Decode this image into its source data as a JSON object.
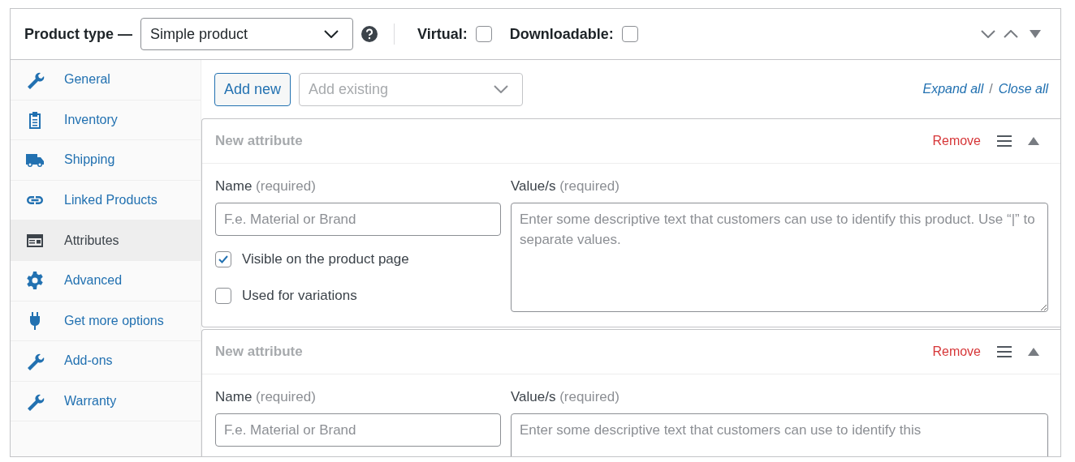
{
  "header": {
    "label": "Product type —",
    "product_type": "Simple product",
    "options": [
      {
        "label": "Virtual:",
        "checked": false
      },
      {
        "label": "Downloadable:",
        "checked": false
      }
    ]
  },
  "sidebar": {
    "items": [
      {
        "label": "General",
        "selected": false
      },
      {
        "label": "Inventory",
        "selected": false
      },
      {
        "label": "Shipping",
        "selected": false
      },
      {
        "label": "Linked Products",
        "selected": false
      },
      {
        "label": "Attributes",
        "selected": true
      },
      {
        "label": "Advanced",
        "selected": false
      },
      {
        "label": "Get more options",
        "selected": false
      },
      {
        "label": "Add-ons",
        "selected": false
      },
      {
        "label": "Warranty",
        "selected": false
      }
    ]
  },
  "toolbar": {
    "add_new": "Add new",
    "add_existing": {
      "placeholder": "Add existing"
    },
    "expand_all": "Expand all",
    "separator": "/",
    "close_all": "Close all"
  },
  "attributes": [
    {
      "title": "New attribute",
      "remove": "Remove",
      "name_label": "Name",
      "name_hint": "(required)",
      "name_placeholder": "F.e. Material or Brand",
      "values_label": "Value/s",
      "values_hint": "(required)",
      "values_placeholder": "Enter some descriptive text that customers can use to identify this product. Use “|” to separate values.",
      "options": [
        {
          "label": "Visible on the product page",
          "checked": true
        },
        {
          "label": "Used for variations",
          "checked": false
        }
      ]
    },
    {
      "title": "New attribute",
      "remove": "Remove",
      "name_label": "Name",
      "name_hint": "(required)",
      "name_placeholder": "F.e. Material or Brand",
      "values_label": "Value/s",
      "values_hint": "(required)",
      "values_placeholder": "Enter some descriptive text that customers can use to identify this"
    }
  ]
}
